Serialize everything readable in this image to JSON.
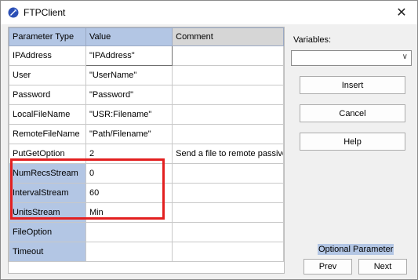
{
  "window": {
    "title": "FTPClient",
    "app_icon": "ftp-app-icon",
    "close_icon": "close-icon",
    "close_glyph": "✕"
  },
  "grid": {
    "headers": [
      "Parameter Type",
      "Value",
      "Comment"
    ],
    "rows": [
      {
        "param": "IPAddress",
        "value": "\"IPAddress\"",
        "comment": ""
      },
      {
        "param": "User",
        "value": "\"UserName\"",
        "comment": ""
      },
      {
        "param": "Password",
        "value": "\"Password\"",
        "comment": ""
      },
      {
        "param": "LocalFileName",
        "value": "\"USR:Filename\"",
        "comment": ""
      },
      {
        "param": "RemoteFileName",
        "value": "\"Path/Filename\"",
        "comment": ""
      },
      {
        "param": "PutGetOption",
        "value": "2",
        "comment": "Send a file to remote passive"
      },
      {
        "param": "NumRecsStream",
        "value": "0",
        "comment": ""
      },
      {
        "param": "IntervalStream",
        "value": "60",
        "comment": ""
      },
      {
        "param": "UnitsStream",
        "value": "Min",
        "comment": ""
      },
      {
        "param": "FileOption",
        "value": "",
        "comment": ""
      },
      {
        "param": "Timeout",
        "value": "",
        "comment": ""
      }
    ]
  },
  "variables": {
    "label": "Variables:",
    "selected": ""
  },
  "buttons": {
    "insert": "Insert",
    "cancel": "Cancel",
    "help": "Help",
    "prev": "Prev",
    "next": "Next"
  },
  "legend": {
    "optional": "Optional Parameter"
  },
  "colors": {
    "header_blue": "#b3c6e4",
    "optional_blue": "#b3c6e4",
    "highlight_red": "#e32020"
  }
}
